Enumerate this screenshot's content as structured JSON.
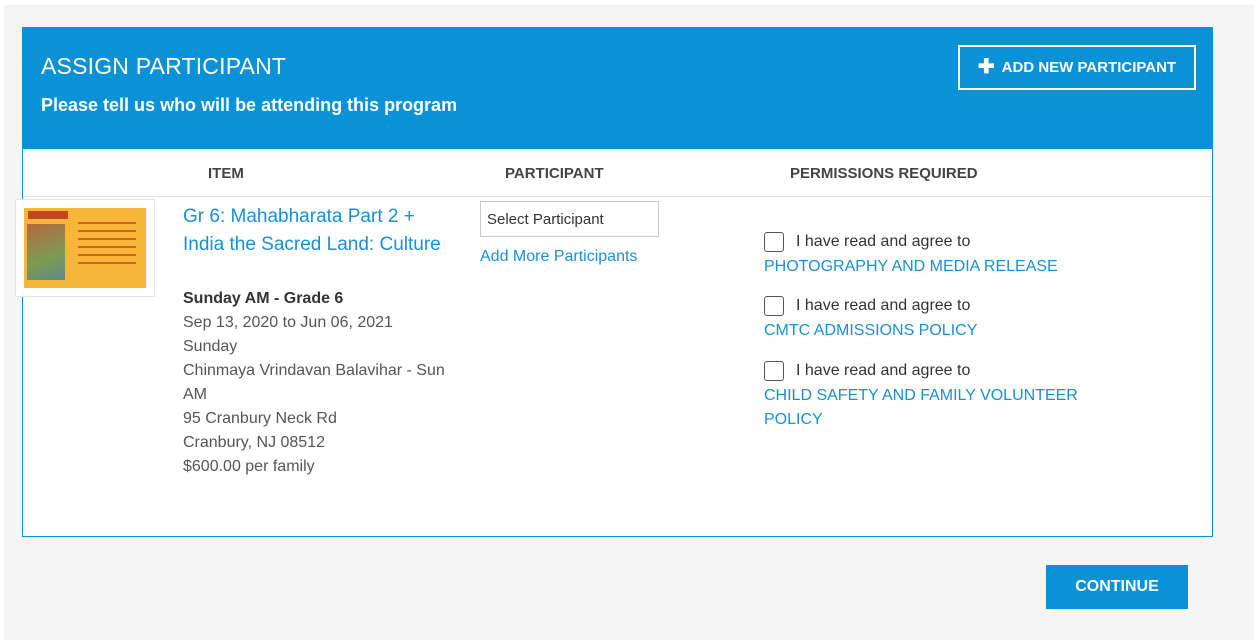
{
  "header": {
    "title": "ASSIGN PARTICIPANT",
    "subtitle": "Please tell us who will be attending this program",
    "add_new_label": "ADD NEW PARTICIPANT",
    "add_new_icon": "plus-icon"
  },
  "columns": {
    "item": "ITEM",
    "participant": "PARTICIPANT",
    "permissions": "PERMISSIONS REQUIRED"
  },
  "item": {
    "title": "Gr 6: Mahabharata Part 2 + India the Sacred Land: Culture",
    "subtitle": "Sunday AM - Grade 6",
    "dates": "Sep 13, 2020 to Jun 06, 2021",
    "day": "Sunday",
    "location": "Chinmaya Vrindavan Balavihar - Sun AM",
    "address1": "95 Cranbury Neck Rd",
    "address2": "Cranbury, NJ 08512",
    "price": "$600.00 per family"
  },
  "participant": {
    "select_value": "Select Participant",
    "add_more_label": "Add More Participants"
  },
  "permissions": [
    {
      "text": "I have read and agree to",
      "link": "PHOTOGRAPHY AND MEDIA RELEASE",
      "checked": false
    },
    {
      "text": "I have read and agree to",
      "link": "CMTC ADMISSIONS POLICY",
      "checked": false
    },
    {
      "text": "I have read and agree to",
      "link": "CHILD SAFETY AND FAMILY VOLUNTEER POLICY",
      "checked": false
    }
  ],
  "footer": {
    "continue_label": "CONTINUE"
  },
  "colors": {
    "accent": "#0a91d6",
    "link": "#1a8fd6",
    "page_bg": "#f5f5f5"
  }
}
